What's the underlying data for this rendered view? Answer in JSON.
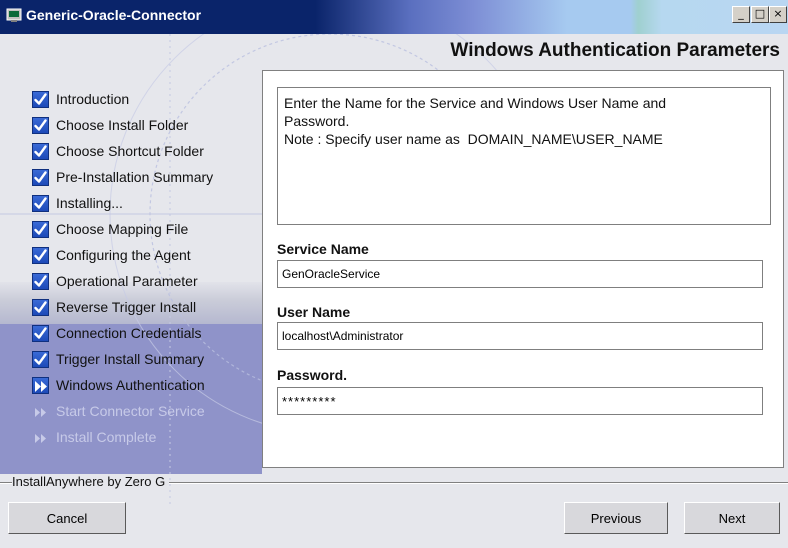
{
  "window": {
    "title": "Generic-Oracle-Connector",
    "controls": {
      "minimize": "_",
      "maximize": "□",
      "close": "×"
    }
  },
  "page_title": "Windows Authentication Parameters",
  "steps": [
    {
      "label": "Introduction",
      "state": "done"
    },
    {
      "label": "Choose Install Folder",
      "state": "done"
    },
    {
      "label": "Choose Shortcut Folder",
      "state": "done"
    },
    {
      "label": "Pre-Installation Summary",
      "state": "done"
    },
    {
      "label": "Installing...",
      "state": "done"
    },
    {
      "label": "Choose Mapping File",
      "state": "done"
    },
    {
      "label": "Configuring the Agent",
      "state": "done"
    },
    {
      "label": "Operational Parameter",
      "state": "done"
    },
    {
      "label": "Reverse Trigger Install",
      "state": "done"
    },
    {
      "label": "Connection Credentials",
      "state": "done"
    },
    {
      "label": "Trigger Install Summary",
      "state": "done"
    },
    {
      "label": "Windows Authentication",
      "state": "current"
    },
    {
      "label": "Start Connector Service",
      "state": "future"
    },
    {
      "label": "Install Complete",
      "state": "future"
    }
  ],
  "instructions": {
    "line1": "Enter the Name for the Service and Windows User Name and",
    "line2": "Password.",
    "line3": "Note : Specify user name as  DOMAIN_NAME\\USER_NAME"
  },
  "fields": {
    "service_name": {
      "label": "Service Name",
      "value": "GenOracleService"
    },
    "user_name": {
      "label": "User Name",
      "value": "localhost\\Administrator"
    },
    "password": {
      "label": "Password.",
      "value": "*********"
    }
  },
  "footer": {
    "brand": "InstallAnywhere by Zero G"
  },
  "buttons": {
    "cancel": "Cancel",
    "previous": "Previous",
    "next": "Next"
  },
  "colors": {
    "titlebar": "#0a246a",
    "accent_check": "#2a5bd0",
    "sidebar_lavender": "#8f93c9"
  }
}
